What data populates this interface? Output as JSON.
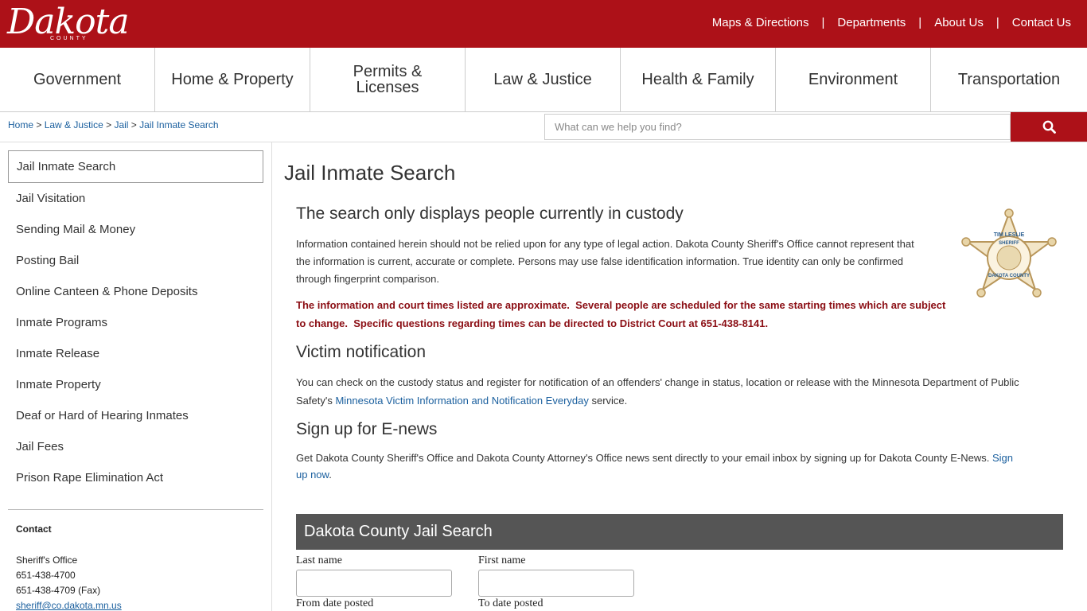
{
  "header": {
    "logo_text": "Dakota",
    "logo_sub": "COUNTY",
    "links": [
      "Maps & Directions",
      "Departments",
      "About Us",
      "Contact Us"
    ],
    "separator": "|",
    "brand_color": "#ad1118"
  },
  "nav": {
    "items": [
      "Government",
      "Home & Property",
      "Permits & Licenses",
      "Law & Justice",
      "Health & Family",
      "Environment",
      "Transportation"
    ]
  },
  "breadcrumb": {
    "items": [
      "Home",
      "Law & Justice",
      "Jail",
      "Jail Inmate Search"
    ],
    "sep": " > "
  },
  "search": {
    "placeholder": "What can we help you find?",
    "icon": "search-icon"
  },
  "sidebar": {
    "items": [
      "Jail Inmate Search",
      "Jail Visitation",
      "Sending Mail & Money",
      "Posting Bail",
      "Online Canteen & Phone Deposits",
      "Inmate Programs",
      "Inmate Release",
      "Inmate Property",
      "Deaf or Hard of Hearing Inmates",
      "Jail Fees",
      "Prison Rape Elimination Act"
    ],
    "contact_title": "Contact",
    "contact_office": "Sheriff's Office",
    "contact_phone": "651-438-4700",
    "contact_fax": "651-438-4709 (Fax)",
    "contact_email": "sheriff@co.dakota.mn.us"
  },
  "main": {
    "title": "Jail Inmate Search",
    "s1_heading": "The search only displays people currently in custody",
    "s1_p1_l1": "Information contained herein should not be relied upon for any type of legal action. Dakota County Sheriff's Office cannot represent that",
    "s1_p1_l2": "the information is current, accurate or complete. Persons may use false identification information. True identity can only be confirmed",
    "s1_p1_l3": "through fingerprint comparison.",
    "s1_p2_l1": "The information and court times listed are approximate.  Several people are scheduled for the same starting times which are subject",
    "s1_p2_l2": "to change.  Specific questions regarding times can be directed to District Court at 651-438-8141.",
    "s2_heading": "Victim notification",
    "s2_p_l1": "You can check on the custody status and register for notification of an offenders' change in status, location or release with the Minnesota Department of Public",
    "s2_p_l2_pre": "Safety's ",
    "s2_p_link": "Minnesota Victim Information and Notification Everyday",
    "s2_p_l2_post": " service.",
    "s3_heading": "Sign up for E-news",
    "s3_p_l1": "Get Dakota County Sheriff's Office and Dakota County Attorney's Office news sent directly to your email inbox by signing up for Dakota County E-News. ",
    "s3_link_a": "Sign",
    "s3_link_b": "up now",
    "s3_period": "."
  },
  "badge": {
    "top_text": "TIM LESLIE",
    "mid_text": "SHERIFF",
    "bottom_text": "DAKOTA COUNTY"
  },
  "jail_search": {
    "heading": "Dakota County Jail Search",
    "last_name_label": "Last name",
    "first_name_label": "First name",
    "from_date_label": "From date posted",
    "to_date_label": "To date posted"
  }
}
